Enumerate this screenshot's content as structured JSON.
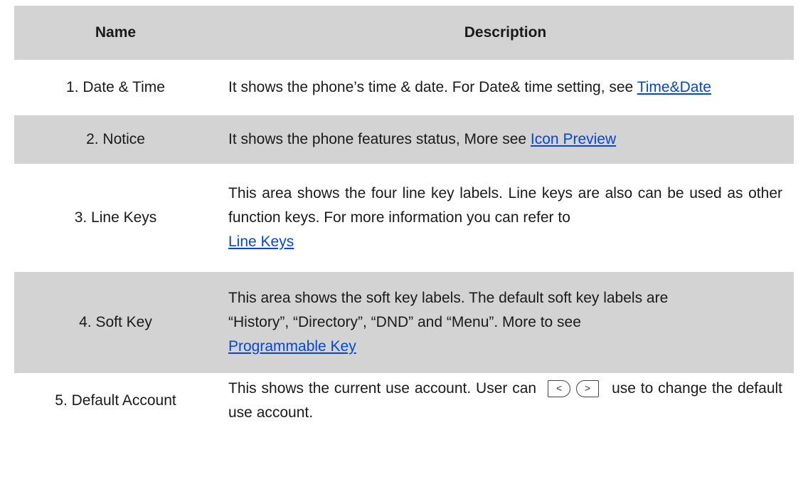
{
  "header": {
    "name": "Name",
    "description": "Description"
  },
  "rows": [
    {
      "name": "1. Date & Time",
      "text": "It shows the phone’s time & date. For Date& time setting, see",
      "link": "Time&Date"
    },
    {
      "name": "2. Notice",
      "text": "It shows the phone features status, More see",
      "link": "Icon Preview"
    },
    {
      "name": "3. Line Keys",
      "text_lines": [
        "This area shows the four line key labels. Line keys are also can be used as other function keys. For more information you can refer to"
      ],
      "link": "Line Keys"
    },
    {
      "name": "4. Soft Key",
      "text_lines": [
        "This area shows the soft key labels. The default soft key labels are",
        "“History”, “Directory”, “DND” and “Menu”. More to see"
      ],
      "link": "Programmable Key"
    },
    {
      "name": "5. Default Account",
      "text_before": "This shows the current use account. User can",
      "icon_left": "<",
      "icon_right": ">",
      "text_after": "use to change the default use account."
    }
  ]
}
